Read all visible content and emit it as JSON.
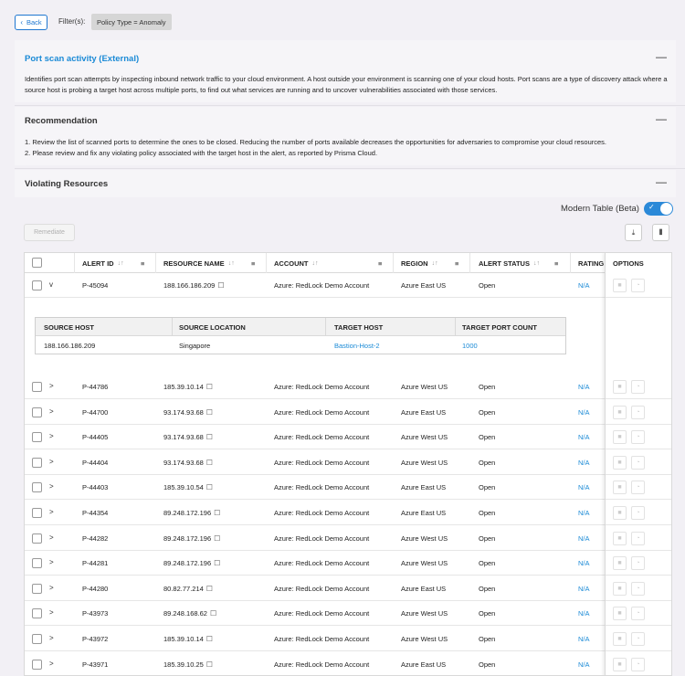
{
  "header": {
    "back_label": "Back",
    "filters_label": "Filter(s):",
    "filter_chip": "Policy Type = Anomaly"
  },
  "policy": {
    "title": "Port scan activity (External)",
    "description": "Identifies port scan attempts by inspecting inbound network traffic to your cloud environment. A host outside your environment is scanning one of your cloud hosts. Port scans are a type of discovery attack where a source host is probing a target host across multiple ports, to find out what services are running and to uncover vulnerabilities associated with those services."
  },
  "recommendation": {
    "title": "Recommendation",
    "line1": "1. Review the list of scanned ports to determine the ones to be closed. Reducing the number of ports available decreases the opportunities for adversaries to compromise your cloud resources.",
    "line2": "2. Please review and fix any violating policy associated with the target host in the alert, as reported by Prisma Cloud."
  },
  "violating": {
    "title": "Violating Resources",
    "toggle_label": "Modern Table (Beta)",
    "toggle_on": true,
    "remediate_label": "Remediate"
  },
  "icons": {
    "collapse": "minus-icon",
    "download": "download-icon",
    "columns": "columns-icon",
    "external": "external-link-icon"
  },
  "table": {
    "columns": [
      "ALERT ID",
      "RESOURCE NAME",
      "ACCOUNT",
      "REGION",
      "ALERT STATUS",
      "RATING",
      "OPTIONS"
    ],
    "expanded_row": {
      "alert_id": "P-45094",
      "resource": "188.166.186.209",
      "account": "Azure: RedLock Demo Account",
      "region": "Azure East US",
      "status": "Open",
      "rating": "N/A",
      "expander": "v",
      "detail": {
        "headers": [
          "SOURCE HOST",
          "SOURCE LOCATION",
          "TARGET HOST",
          "TARGET PORT COUNT"
        ],
        "source_host": "188.166.186.209",
        "source_location": "Singapore",
        "target_host": "Bastion-Host-2",
        "target_port_count": "1000"
      }
    },
    "rows": [
      {
        "alert_id": "P-44786",
        "resource": "185.39.10.14",
        "account": "Azure: RedLock Demo Account",
        "region": "Azure West US",
        "status": "Open",
        "rating": "N/A",
        "expander": ">"
      },
      {
        "alert_id": "P-44700",
        "resource": "93.174.93.68",
        "account": "Azure: RedLock Demo Account",
        "region": "Azure East US",
        "status": "Open",
        "rating": "N/A",
        "expander": ">"
      },
      {
        "alert_id": "P-44405",
        "resource": "93.174.93.68",
        "account": "Azure: RedLock Demo Account",
        "region": "Azure West US",
        "status": "Open",
        "rating": "N/A",
        "expander": ">"
      },
      {
        "alert_id": "P-44404",
        "resource": "93.174.93.68",
        "account": "Azure: RedLock Demo Account",
        "region": "Azure West US",
        "status": "Open",
        "rating": "N/A",
        "expander": ">"
      },
      {
        "alert_id": "P-44403",
        "resource": "185.39.10.54",
        "account": "Azure: RedLock Demo Account",
        "region": "Azure East US",
        "status": "Open",
        "rating": "N/A",
        "expander": ">"
      },
      {
        "alert_id": "P-44354",
        "resource": "89.248.172.196",
        "account": "Azure: RedLock Demo Account",
        "region": "Azure East US",
        "status": "Open",
        "rating": "N/A",
        "expander": ">"
      },
      {
        "alert_id": "P-44282",
        "resource": "89.248.172.196",
        "account": "Azure: RedLock Demo Account",
        "region": "Azure West US",
        "status": "Open",
        "rating": "N/A",
        "expander": ">"
      },
      {
        "alert_id": "P-44281",
        "resource": "89.248.172.196",
        "account": "Azure: RedLock Demo Account",
        "region": "Azure West US",
        "status": "Open",
        "rating": "N/A",
        "expander": ">"
      },
      {
        "alert_id": "P-44280",
        "resource": "80.82.77.214",
        "account": "Azure: RedLock Demo Account",
        "region": "Azure East US",
        "status": "Open",
        "rating": "N/A",
        "expander": ">"
      },
      {
        "alert_id": "P-43973",
        "resource": "89.248.168.62",
        "account": "Azure: RedLock Demo Account",
        "region": "Azure West US",
        "status": "Open",
        "rating": "N/A",
        "expander": ">"
      },
      {
        "alert_id": "P-43972",
        "resource": "185.39.10.14",
        "account": "Azure: RedLock Demo Account",
        "region": "Azure West US",
        "status": "Open",
        "rating": "N/A",
        "expander": ">"
      },
      {
        "alert_id": "P-43971",
        "resource": "185.39.10.25",
        "account": "Azure: RedLock Demo Account",
        "region": "Azure East US",
        "status": "Open",
        "rating": "N/A",
        "expander": ">"
      }
    ]
  }
}
